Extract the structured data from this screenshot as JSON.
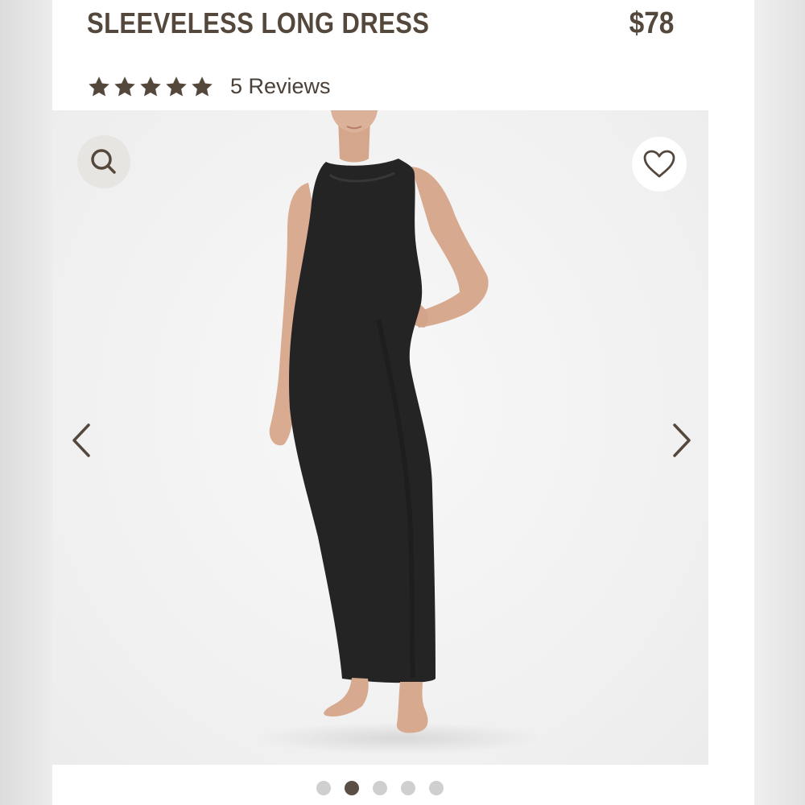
{
  "product": {
    "title": "SLEEVELESS LONG DRESS",
    "price": "$78"
  },
  "rating": {
    "stars": 5,
    "max_stars": 5,
    "reviews_label": "5 Reviews"
  },
  "gallery": {
    "image_count": 5,
    "active_index": 1,
    "icons": {
      "search": "search-icon",
      "favorite": "heart-icon",
      "previous": "chevron-left-icon",
      "next": "chevron-right-icon"
    }
  },
  "colors": {
    "brand_text": "#54483d",
    "dress": "#252425",
    "skin": "#d9ac93",
    "dot_active": "#5b4f45",
    "dot_inactive": "#cfcfcf"
  }
}
